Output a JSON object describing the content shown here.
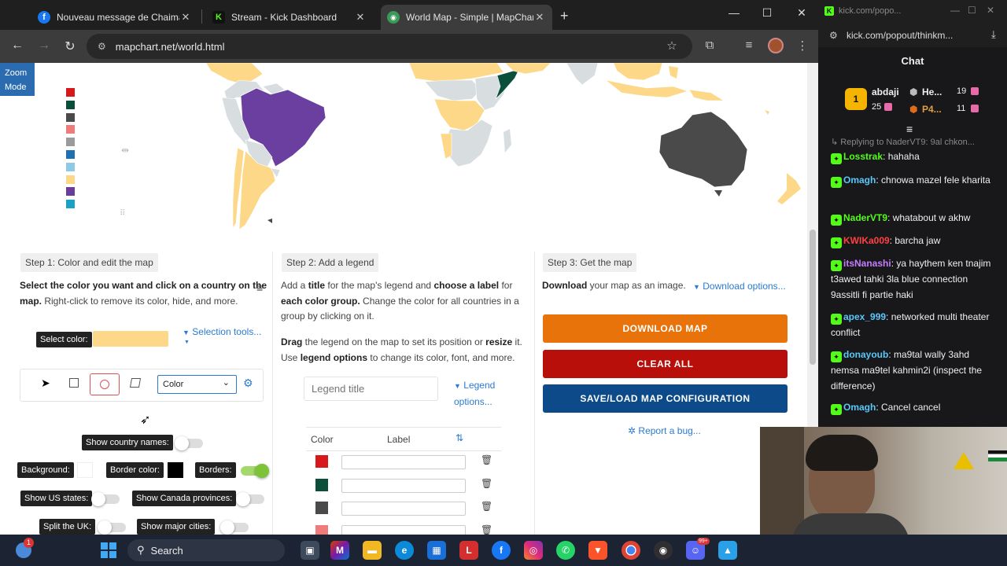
{
  "browser": {
    "tab_dropdown_icon": "chevron-down-icon",
    "tabs": [
      {
        "title": "Nouveau message de Chaima c",
        "favicon": "f",
        "favicon_color": "#1877f2"
      },
      {
        "title": "Stream - Kick Dashboard",
        "favicon": "K",
        "favicon_color": "#53fc18"
      },
      {
        "title": "World Map - Simple | MapChar",
        "favicon": "◉",
        "favicon_color": "#3a9a5a"
      }
    ],
    "url": "mapchart.net/world.html"
  },
  "map": {
    "zoom_mode": "Zoom Mode",
    "palette": [
      "#d7191c",
      "#0b4f3b",
      "#4a4a4a",
      "#f07b7b",
      "#9b9b9b",
      "#1f6fb2",
      "#8ecae6",
      "#fcd888",
      "#6a3d9a",
      "#1aa2c6"
    ],
    "colors": {
      "purple": "#6b3fa0",
      "yellow": "#fcd888",
      "gray": "#d8dde0",
      "dark": "#4a4a4a",
      "green": "#0b4f3b"
    }
  },
  "step1": {
    "title": "Step 1: Color and edit the map",
    "line1_a": "Select the color you want and ",
    "line1_b": "click on a country",
    "line1_c": " on the",
    "line2_a": "map.",
    "line2_b": " Right-click to remove its color, hide, and more.",
    "select_color_label": "Select color:",
    "selected_color": "#fcd888",
    "selection_tools": "Selection tools...",
    "color_select_value": "Color",
    "show_country_names": "Show country names:",
    "background": "Background:",
    "border_color": "Border color:",
    "borders": "Borders:",
    "show_us_states": "Show US states:",
    "show_canada": "Show Canada provinces:",
    "split_uk": "Split the UK:",
    "show_major_cities": "Show major cities:"
  },
  "step2": {
    "title": "Step 2: Add a legend",
    "p1_a": "Add a ",
    "p1_b": "title",
    "p1_c": " for the map's legend and ",
    "p1_d": "choose a label",
    "p1_e": " for",
    "p1_f": "each color group.",
    "p1_g": " Change the color for all countries in a",
    "p1_h": "group by clicking on it.",
    "p2_a": "Drag",
    "p2_b": " the legend on the map to set its position or ",
    "p2_c": "resize",
    "p2_d": " it.",
    "p2_e": "Use ",
    "p2_f": "legend options",
    "p2_g": " to change its color, font, and more.",
    "legend_title_placeholder": "Legend title",
    "legend_options_1": "Legend",
    "legend_options_2": "options...",
    "col_color": "Color",
    "col_label": "Label",
    "rows": [
      "#d7191c",
      "#0b4f3b",
      "#4a4a4a",
      "#f07b7b"
    ]
  },
  "step3": {
    "title": "Step 3: Get the map",
    "text_a": "Download",
    "text_b": " your map as an image.",
    "download_options": "Download options...",
    "download": "DOWNLOAD MAP",
    "clear": "CLEAR ALL",
    "save_load": "SAVE/LOAD MAP CONFIGURATION",
    "report": "Report a bug...",
    "download_color": "#e8730a",
    "clear_color": "#b80f0a",
    "save_color": "#0d4a8a"
  },
  "chat": {
    "window_title": "kick.com/popo...",
    "url": "kick.com/popout/thinkm...",
    "header": "Chat",
    "top": [
      {
        "name": "abdaji",
        "num": "25",
        "rank_icon": "rank-1-icon"
      },
      {
        "name": "He...",
        "num": "19"
      },
      {
        "name": "P4...",
        "num": "11"
      }
    ],
    "replying": "Replying to NaderVT9: 9al chkon...",
    "messages": [
      {
        "user": "Losstrak",
        "color": "#53fc18",
        "text": "hahaha"
      },
      {
        "user": "Omagh",
        "color": "#5ac8fa",
        "text": "chnowa mazel fele kharita"
      },
      {
        "user": "NaderVT9",
        "color": "#53fc18",
        "text": "whatabout w akhw"
      },
      {
        "user": "KWIKa009",
        "color": "#ff4040",
        "text": "barcha jaw"
      },
      {
        "user": "itsNanashi",
        "color": "#c77dff",
        "text": "ya haythem ken tnajim t3awed tahki 3la blue connection 9assitli fi partie haki"
      },
      {
        "user": "apex_999",
        "color": "#5ac8fa",
        "text": "networked multi theater conflict"
      },
      {
        "user": "donayoub",
        "color": "#5ac8fa",
        "text": "ma9tal wally 3ahd nemsa ma9tel kahmin2i (inspect the difference)"
      },
      {
        "user": "Omagh",
        "color": "#5ac8fa",
        "text": "Cancel cancel"
      }
    ]
  },
  "taskbar": {
    "search": "Search",
    "badge": "1",
    "badge2": "99+"
  }
}
